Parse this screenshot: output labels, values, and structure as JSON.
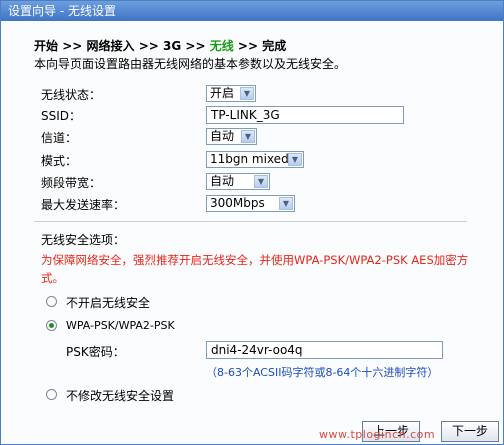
{
  "window": {
    "title": "设置向导 - 无线设置"
  },
  "steps": {
    "s1": "开始",
    "s2": "网络接入",
    "s3": "3G",
    "s4": "无线",
    "s5": "完成",
    "sep": ">>"
  },
  "intro": "本向导页面设置路由器无线网络的基本参数以及无线安全。",
  "form": {
    "wireless_status": {
      "label": "无线状态：",
      "value": "开启"
    },
    "ssid": {
      "label": "SSID：",
      "value": "TP-LINK_3G"
    },
    "channel": {
      "label": "信道：",
      "value": "自动"
    },
    "mode": {
      "label": "模式：",
      "value": "11bgn mixed"
    },
    "bandwidth": {
      "label": "频段带宽：",
      "value": "自动"
    },
    "max_rate": {
      "label": "最大发送速率：",
      "value": "300Mbps"
    }
  },
  "security": {
    "title": "无线安全选项：",
    "warning_line1": "为保障网络安全，强烈推荐开启无线安全，并使用WPA-PSK/WPA2-PSK AES加密方",
    "warning_line2": "式。",
    "option_off": "不开启无线安全",
    "option_wpa": "WPA-PSK/WPA2-PSK",
    "psk_label": "PSK密码：",
    "psk_value": "dni4-24vr-oo4q",
    "psk_hint": "（8-63个ACSII码字符或8-64个十六进制字符）",
    "option_keep": "不修改无线安全设置",
    "selected": "wpa"
  },
  "buttons": {
    "prev": "上一步",
    "next": "下一步"
  },
  "watermark": "www.tplogincn.com",
  "colors": {
    "titlebar": "#3f74c5",
    "accent_step": "#1a9a1a",
    "warning": "#e8251b",
    "hint": "#1b4cc0"
  }
}
